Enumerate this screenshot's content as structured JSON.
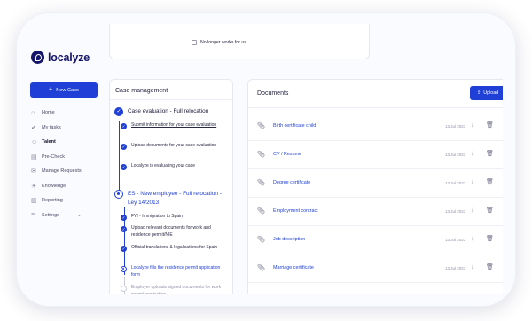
{
  "brand": {
    "name": "localyze"
  },
  "sidebar": {
    "new_case_label": "New Case",
    "items": [
      {
        "label": "Home",
        "icon": "home-icon"
      },
      {
        "label": "My tasks",
        "icon": "check-circle-icon"
      },
      {
        "label": "Talent",
        "icon": "user-icon",
        "active": true
      },
      {
        "label": "Pre-Check",
        "icon": "document-check-icon"
      },
      {
        "label": "Manage Requests",
        "icon": "mail-icon"
      },
      {
        "label": "Knowledge",
        "icon": "lightbulb-icon"
      },
      {
        "label": "Reporting",
        "icon": "report-icon"
      },
      {
        "label": "Settings",
        "icon": "sliders-icon",
        "expandable": true
      }
    ]
  },
  "top_strip": {
    "checkbox_label": "No longer works for us",
    "checked": false
  },
  "case_management": {
    "title": "Case management",
    "milestones": [
      {
        "title": "Case evaluation - Full relocation",
        "status": "done",
        "steps": [
          {
            "text": "Submit information for your case evaluation",
            "status": "done",
            "style": "link"
          },
          {
            "text": "Upload documents for your case evaluation",
            "status": "done"
          },
          {
            "text": "Localyze is evaluating your case",
            "status": "done"
          }
        ]
      },
      {
        "title": "ES - New employee - Full relocation - Ley 14/2013",
        "status": "current",
        "steps": [
          {
            "text": "FYI - Immigration to Spain",
            "status": "done"
          },
          {
            "text": "Upload relevant documents for work and residence permit/NIE",
            "status": "done"
          },
          {
            "text": "Official translations & legalisations for Spain",
            "status": "done"
          },
          {
            "text": "Localyze fills the residence permit application form",
            "status": "current"
          },
          {
            "text": "Employer uploads signed documents for work permit application",
            "status": "pending"
          }
        ]
      }
    ]
  },
  "documents": {
    "title": "Documents",
    "upload_label": "Upload",
    "rows": [
      {
        "name": "Birth certificate child",
        "date": "13 Jul 2023"
      },
      {
        "name": "CV / Resume",
        "date": "13 Jul 2023"
      },
      {
        "name": "Degree certificate",
        "date": "13 Jul 2023"
      },
      {
        "name": "Employment contract",
        "date": "13 Jul 2023"
      },
      {
        "name": "Job description",
        "date": "13 Jul 2023"
      },
      {
        "name": "Marriage certificate",
        "date": "13 Jul 2023"
      }
    ]
  },
  "colors": {
    "accent": "#1f3fd6",
    "brand": "#14146a",
    "text": "#1c1c3a",
    "muted": "#8f90a6"
  }
}
